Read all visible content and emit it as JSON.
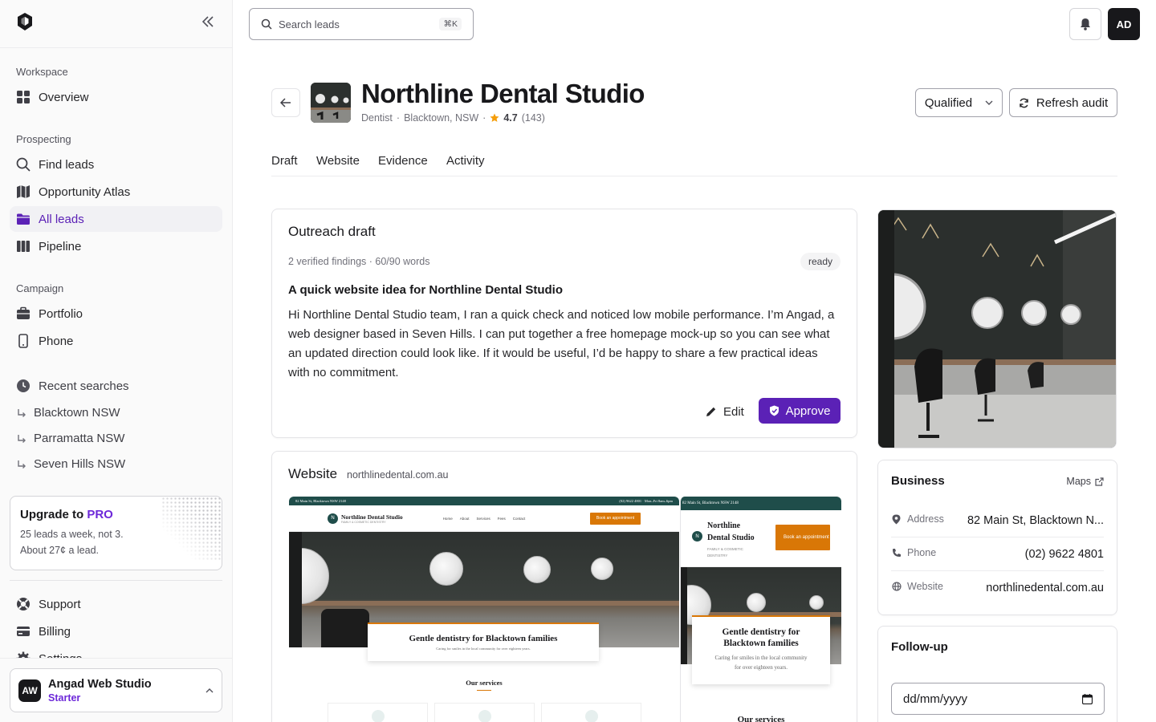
{
  "search": {
    "placeholder": "Search leads",
    "shortcut": "⌘K"
  },
  "user": {
    "initials": "AD"
  },
  "sidebar": {
    "sections": [
      "Workspace",
      "Prospecting",
      "Campaign"
    ],
    "items": [
      {
        "label": "Overview"
      },
      {
        "label": "Find leads"
      },
      {
        "label": "Opportunity Atlas"
      },
      {
        "label": "All leads"
      },
      {
        "label": "Pipeline"
      },
      {
        "label": "Portfolio"
      },
      {
        "label": "Phone"
      }
    ],
    "recent_title": "Recent searches",
    "recent": [
      "Blacktown NSW",
      "Parramatta NSW",
      "Seven Hills NSW"
    ],
    "upgrade": {
      "prefix": "Upgrade to ",
      "brand": "PRO",
      "line1": "25 leads a week, not 3.",
      "line2": "About 27¢ a lead."
    },
    "bottom": [
      "Support",
      "Billing",
      "Settings"
    ],
    "account": {
      "initials": "AW",
      "name": "Angad Web Studio",
      "plan": "Starter"
    }
  },
  "lead": {
    "name": "Northline Dental Studio",
    "category": "Dentist",
    "location": "Blacktown, NSW",
    "rating": "4.7",
    "reviews": "(143)",
    "status": "Qualified",
    "refresh_label": "Refresh audit"
  },
  "tabs": [
    "Draft",
    "Website",
    "Evidence",
    "Activity"
  ],
  "outreach": {
    "title": "Outreach draft",
    "meta": "2 verified findings · 60/90 words",
    "badge": "ready",
    "subject": "A quick website idea for Northline Dental Studio",
    "body": "Hi Northline Dental Studio team, I ran a quick check and noticed low mobile performance. I’m Angad, a web designer based in Seven Hills. I can put together a free homepage mock-up so you can see what an updated direction could look like. If it would be useful, I’d be happy to share a few practical ideas with no commitment.",
    "edit_label": "Edit",
    "approve_label": "Approve"
  },
  "website": {
    "title": "Website",
    "domain": "northlinedental.com.au",
    "mock": {
      "address": "82 Main St, Blacktown NSW 2148",
      "hours": "(02) 9622 4801 · Mon–Fri 8am–6pm",
      "brand": "Northline Dental Studio",
      "brand_line1": "Northline",
      "brand_line2": "Dental Studio",
      "tagline": "FAMILY & COSMETIC DENTISTRY",
      "nav": [
        "Home",
        "About",
        "Services",
        "Fees",
        "Contact"
      ],
      "cta": "Book an appointment",
      "hero_title": "Gentle dentistry for Blacktown families",
      "hero_title_line1": "Gentle dentistry for",
      "hero_title_line2": "Blacktown families",
      "hero_sub": "Caring for smiles in the local community for over eighteen years.",
      "hero_sub_line1": "Caring for smiles in the local community",
      "hero_sub_line2": "for over eighteen years.",
      "services": "Our services"
    }
  },
  "business": {
    "title": "Business",
    "maps_label": "Maps",
    "rows": [
      {
        "label": "Address",
        "value": "82 Main St, Blacktown N..."
      },
      {
        "label": "Phone",
        "value": "(02) 9622 4801"
      },
      {
        "label": "Website",
        "value": "northlinedental.com.au"
      }
    ]
  },
  "followup": {
    "title": "Follow-up",
    "date_placeholder": "dd/mm/yyyy"
  },
  "colors": {
    "accent": "#5b21b6",
    "brand_teal": "#1f4d4a",
    "cta_orange": "#d97706"
  }
}
